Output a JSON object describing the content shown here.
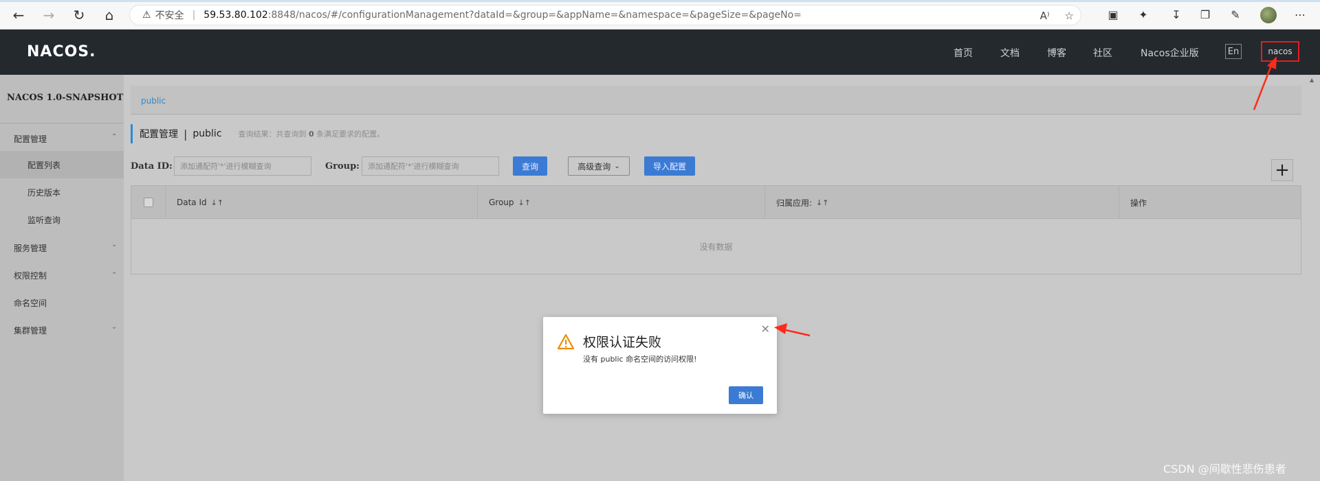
{
  "browser": {
    "insecure_label": "不安全",
    "url_host": "59.53.80.102",
    "url_rest": ":8848/nacos/#/configurationManagement?dataId=&group=&appName=&namespace=&pageSize=&pageNo="
  },
  "header": {
    "logo": "NACOS.",
    "nav": [
      "首页",
      "文档",
      "博客",
      "社区",
      "Nacos企业版"
    ],
    "lang": "En",
    "user": "nacos"
  },
  "sidebar": {
    "title": "NACOS 1.0-SNAPSHOT",
    "items": [
      {
        "label": "配置管理",
        "expanded": true,
        "children": [
          "配置列表",
          "历史版本",
          "监听查询"
        ]
      },
      {
        "label": "服务管理"
      },
      {
        "label": "权限控制"
      },
      {
        "label": "命名空间"
      },
      {
        "label": "集群管理"
      }
    ]
  },
  "main": {
    "namespace_link": "public",
    "page_title": "配置管理",
    "page_ns": "public",
    "summary_prefix": "查询结果：共查询到",
    "summary_count": "0",
    "summary_suffix": "条满足要求的配置。",
    "data_id_label": "Data ID:",
    "data_id_placeholder": "添加通配符'*'进行模糊查询",
    "group_label": "Group:",
    "group_placeholder": "添加通配符'*'进行模糊查询",
    "query_button": "查询",
    "advanced_button": "高级查询",
    "import_button": "导入配置",
    "columns": [
      "Data Id",
      "Group",
      "归属应用:",
      "操作"
    ],
    "empty_text": "没有数据"
  },
  "dialog": {
    "title": "权限认证失败",
    "message": "没有 public 命名空间的访问权限!",
    "ok": "确认"
  },
  "watermark": "CSDN @间歇性悲伤患者"
}
